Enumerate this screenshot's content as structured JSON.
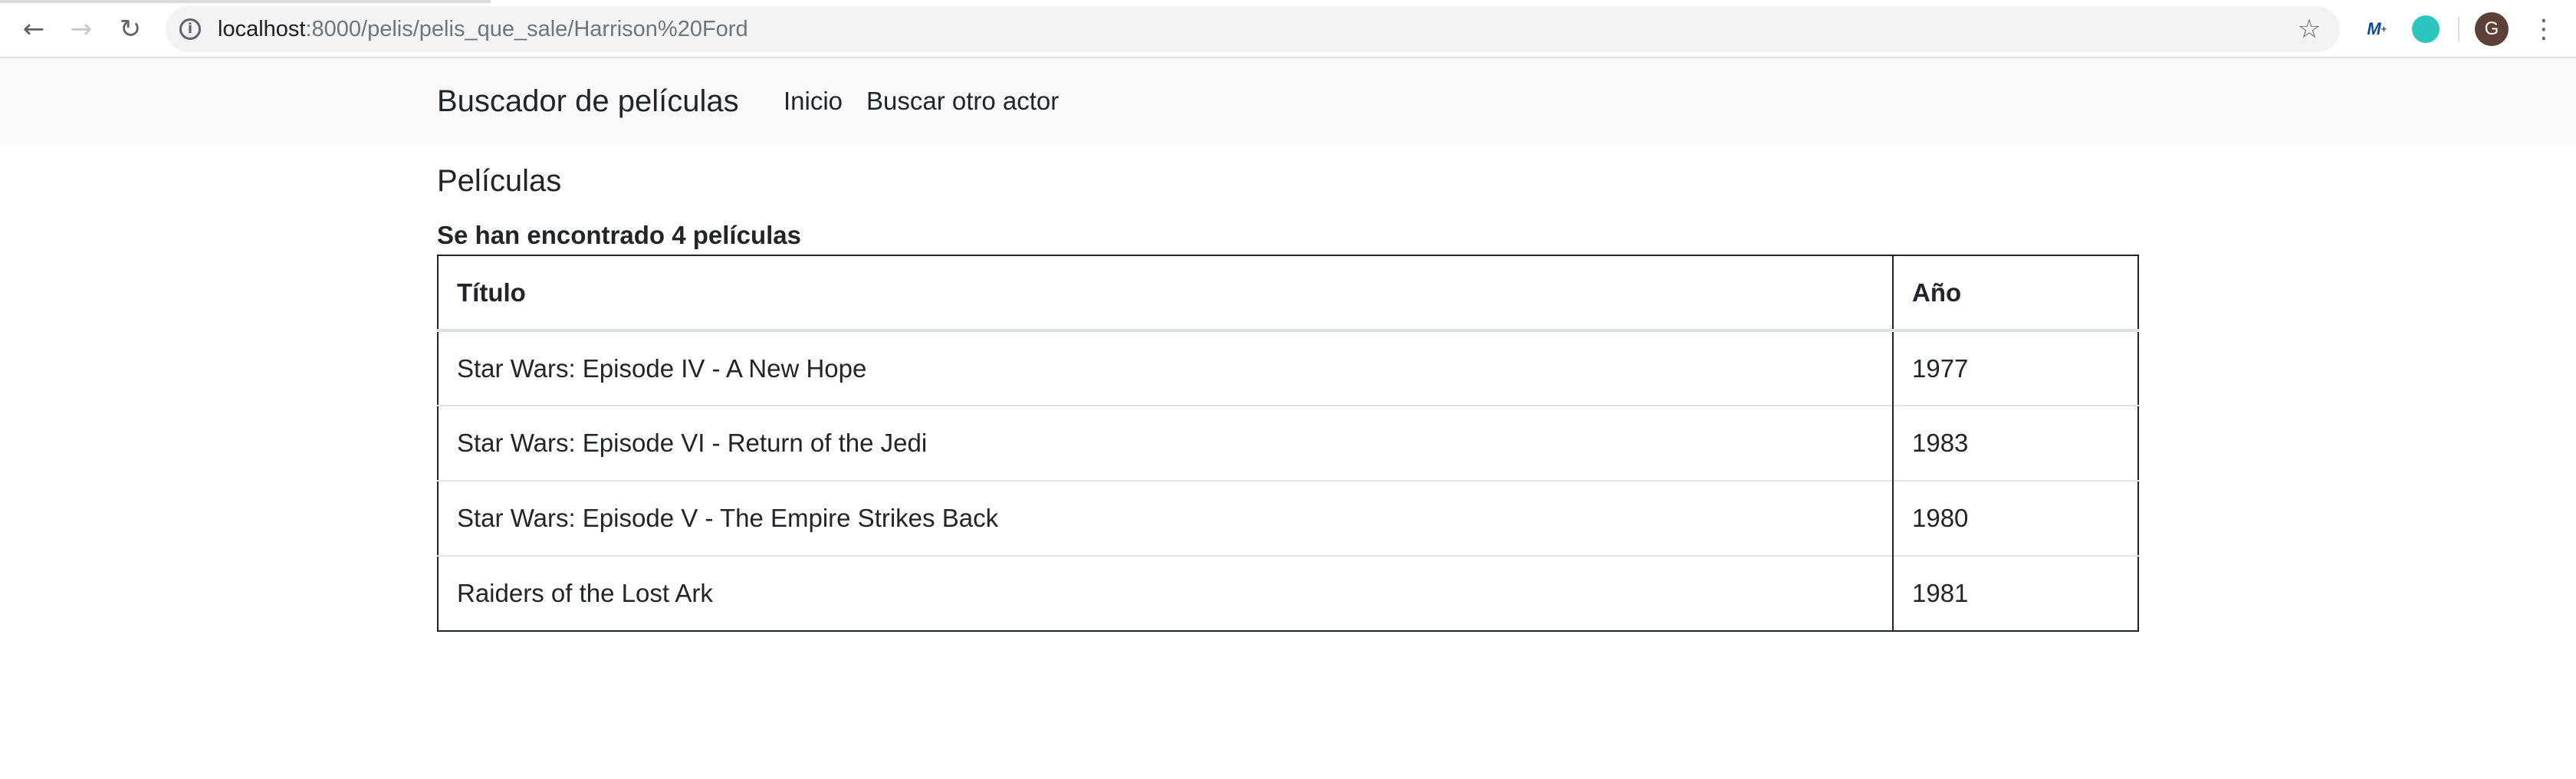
{
  "browser": {
    "url_host": "localhost",
    "url_path": ":8000/pelis/pelis_que_sale/Harrison%20Ford",
    "back_icon": "arrow-back-icon",
    "forward_icon": "arrow-forward-icon",
    "reload_icon": "reload-icon",
    "info_icon": "info-icon",
    "bookmark_icon": "star-icon",
    "extension_icon_1": "movistar-extension-icon",
    "extension_icon_2": "teal-circle-extension-icon",
    "avatar_letter": "G",
    "avatar_color": "#5d4037",
    "menu_icon": "kebab-menu-icon"
  },
  "navbar": {
    "brand": "Buscador de películas",
    "links": [
      {
        "label": "Inicio"
      },
      {
        "label": "Buscar otro actor"
      }
    ]
  },
  "main": {
    "heading": "Películas",
    "result_count": "Se han encontrado 4 películas",
    "table": {
      "columns": [
        "Título",
        "Año"
      ],
      "rows": [
        {
          "title": "Star Wars: Episode IV - A New Hope",
          "year": "1977"
        },
        {
          "title": "Star Wars: Episode VI - Return of the Jedi",
          "year": "1983"
        },
        {
          "title": "Star Wars: Episode V - The Empire Strikes Back",
          "year": "1980"
        },
        {
          "title": "Raiders of the Lost Ark",
          "year": "1981"
        }
      ]
    }
  }
}
